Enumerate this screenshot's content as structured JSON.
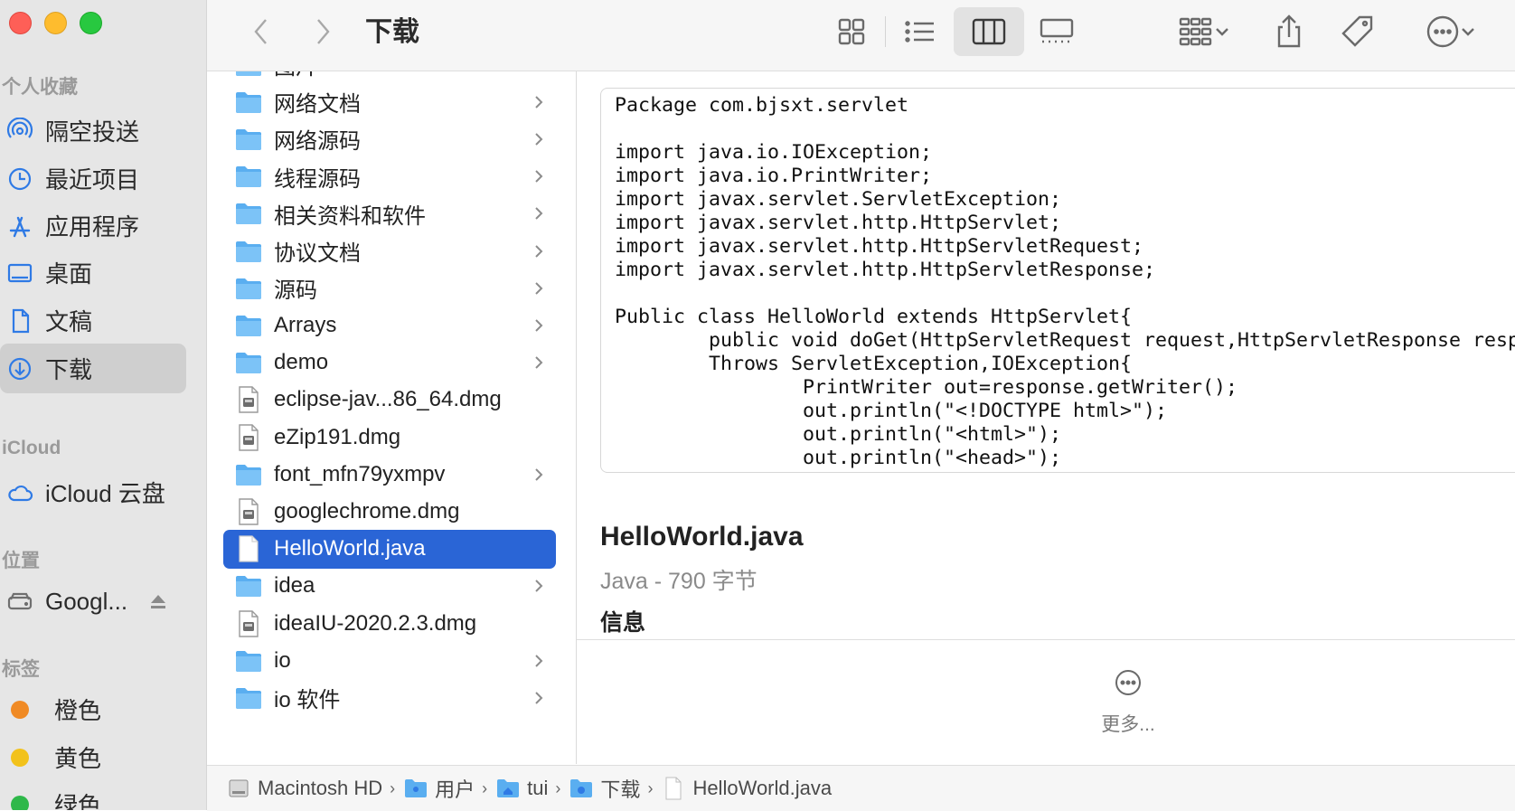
{
  "sidebar": {
    "sections": {
      "favorites": "个人收藏",
      "icloud": "iCloud",
      "locations": "位置",
      "tags": "标签"
    },
    "favorites": [
      {
        "label": "隔空投送",
        "icon": "airdrop-icon"
      },
      {
        "label": "最近项目",
        "icon": "clock-icon"
      },
      {
        "label": "应用程序",
        "icon": "applications-icon"
      },
      {
        "label": "桌面",
        "icon": "desktop-icon"
      },
      {
        "label": "文稿",
        "icon": "document-icon"
      },
      {
        "label": "下载",
        "icon": "download-icon",
        "selected": true
      }
    ],
    "icloud": [
      {
        "label": "iCloud 云盘",
        "icon": "cloud-icon"
      }
    ],
    "locations": [
      {
        "label": "Googl...",
        "icon": "disk-icon"
      }
    ],
    "tags": [
      {
        "label": "橙色",
        "color": "#f08a24"
      },
      {
        "label": "黄色",
        "color": "#f2c21b"
      },
      {
        "label": "绿色",
        "color": "#2fb84a"
      }
    ]
  },
  "toolbar": {
    "title": "下载"
  },
  "files": [
    {
      "name": "图片",
      "type": "folder"
    },
    {
      "name": "网络文档",
      "type": "folder"
    },
    {
      "name": "网络源码",
      "type": "folder"
    },
    {
      "name": "线程源码",
      "type": "folder"
    },
    {
      "name": "相关资料和软件",
      "type": "folder"
    },
    {
      "name": "协议文档",
      "type": "folder"
    },
    {
      "name": "源码",
      "type": "folder"
    },
    {
      "name": "Arrays",
      "type": "folder"
    },
    {
      "name": "demo",
      "type": "folder"
    },
    {
      "name": "eclipse-jav...86_64.dmg",
      "type": "dmg"
    },
    {
      "name": "eZip191.dmg",
      "type": "dmg"
    },
    {
      "name": "font_mfn79yxmpv",
      "type": "folder"
    },
    {
      "name": "googlechrome.dmg",
      "type": "dmg"
    },
    {
      "name": "HelloWorld.java",
      "type": "file",
      "selected": true
    },
    {
      "name": "idea",
      "type": "folder"
    },
    {
      "name": "ideaIU-2020.2.3.dmg",
      "type": "dmg"
    },
    {
      "name": "io",
      "type": "folder"
    },
    {
      "name": "io 软件",
      "type": "folder"
    }
  ],
  "preview": {
    "code": "Package com.bjsxt.servlet\n\nimport java.io.IOException;\nimport java.io.PrintWriter;\nimport javax.servlet.ServletException;\nimport javax.servlet.http.HttpServlet;\nimport javax.servlet.http.HttpServletRequest;\nimport javax.servlet.http.HttpServletResponse;\n\nPublic class HelloWorld extends HttpServlet{\n        public void doGet(HttpServletRequest request,HttpServletResponse response)\n        Throws ServletException,IOException{\n                PrintWriter out=response.getWriter();\n                out.println(\"<!DOCTYPE html>\");\n                out.println(\"<html>\");\n                out.println(\"<head>\");\n                out.println(\"<title>Hello World</title>\");",
    "filename": "HelloWorld.java",
    "meta": "Java - 790 字节",
    "info_heading": "信息",
    "more_label": "更多..."
  },
  "pathbar": [
    {
      "label": "Macintosh HD",
      "icon": "hard-drive-icon"
    },
    {
      "label": "用户",
      "icon": "folder-icon"
    },
    {
      "label": "tui",
      "icon": "home-folder-icon"
    },
    {
      "label": "下载",
      "icon": "downloads-folder-icon"
    },
    {
      "label": "HelloWorld.java",
      "icon": "file-icon"
    }
  ]
}
